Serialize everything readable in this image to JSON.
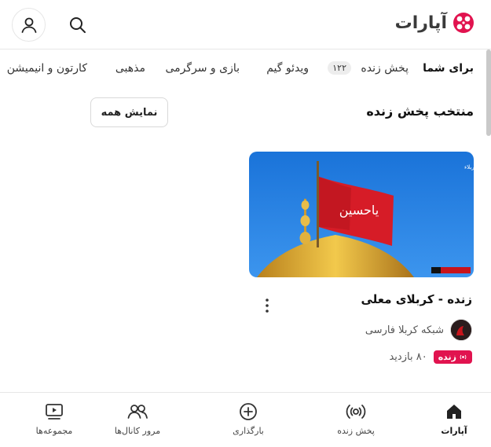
{
  "header": {
    "logo_text": "آپارات",
    "brand_color": "#e1134f"
  },
  "tabs": [
    {
      "label": "برای شما",
      "active": true
    },
    {
      "label": "پخش زنده",
      "badge": "۱۲۲"
    },
    {
      "label": "ویدئو گیم"
    },
    {
      "label": "بازی و سرگرمی"
    },
    {
      "label": "مذهبی"
    },
    {
      "label": "کارتون و انیمیشن"
    }
  ],
  "section": {
    "title": "منتخب پخش زنده",
    "show_all_label": "نمایش همه"
  },
  "card": {
    "title": "زنده - کربلای معلی",
    "channel_name": "شبکه کربلا فارسی",
    "live_label": "زنده",
    "views": "۸۰ بازدید",
    "more_icon": "more-vertical-icon"
  },
  "bottom_nav": [
    {
      "label": "آپارات",
      "icon": "home-icon",
      "active": true
    },
    {
      "label": "پخش زنده",
      "icon": "live-broadcast-icon"
    },
    {
      "label": "بارگذاری",
      "icon": "upload-plus-icon"
    },
    {
      "label": "مرور کانال‌ها",
      "icon": "channels-icon"
    },
    {
      "label": "مجموعه‌ها",
      "icon": "playlist-icon"
    }
  ]
}
